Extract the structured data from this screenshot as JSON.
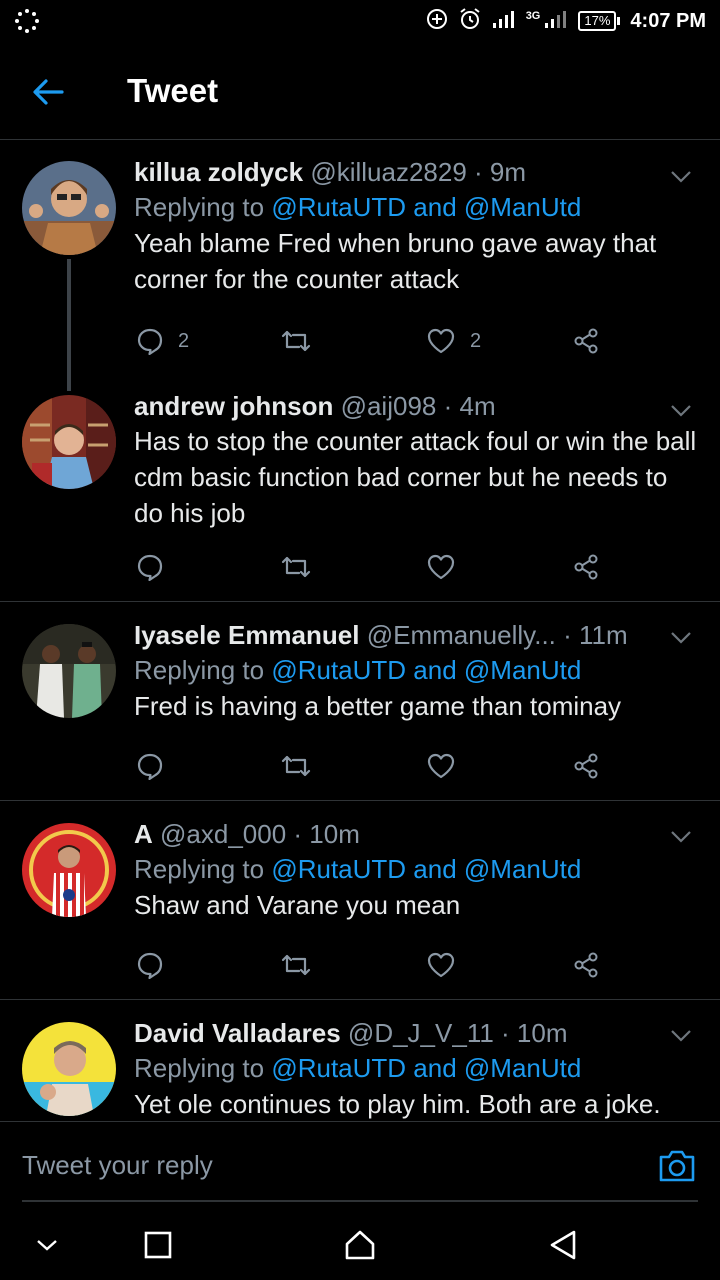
{
  "status_bar": {
    "time": "4:07 PM",
    "battery": "17%",
    "network": "3G"
  },
  "header": {
    "title": "Tweet"
  },
  "tweets": [
    {
      "name": "killua zoldyck",
      "handle": "@killuaz2829",
      "time": "· 9m",
      "replying_prefix": "Replying to",
      "replying_to": "@RutaUTD and @ManUtd",
      "text": "Yeah blame Fred when bruno gave away that corner for the counter attack",
      "reply_count": "2",
      "retweet_count": "",
      "like_count": "2"
    },
    {
      "name": "andrew johnson",
      "handle": "@aij098",
      "time": "· 4m",
      "text": "Has to stop the counter attack foul or win the ball cdm basic function bad corner but he needs to do his job",
      "reply_count": "",
      "retweet_count": "",
      "like_count": ""
    },
    {
      "name": "Iyasele Emmanuel",
      "handle": "@Emmanuelly...",
      "time": "· 11m",
      "replying_prefix": "Replying to",
      "replying_to": "@RutaUTD and @ManUtd",
      "text": "Fred is having a better game than tominay",
      "reply_count": "",
      "retweet_count": "",
      "like_count": ""
    },
    {
      "name": "A",
      "handle": "@axd_000",
      "time": "· 10m",
      "replying_prefix": "Replying to",
      "replying_to": "@RutaUTD and @ManUtd",
      "text": "Shaw and Varane you mean",
      "reply_count": "",
      "retweet_count": "",
      "like_count": ""
    },
    {
      "name": "David Valladares",
      "handle": "@D_J_V_11",
      "time": "· 10m",
      "replying_prefix": "Replying to",
      "replying_to": "@RutaUTD and @ManUtd",
      "text": "Yet ole continues to play him. Both are a joke."
    }
  ],
  "reply_bar": {
    "placeholder": "Tweet your reply"
  },
  "icons": {
    "back": "arrow-left-icon",
    "more": "chevron-down-icon",
    "reply": "speech-bubble-icon",
    "retweet": "retweet-icon",
    "like": "heart-icon",
    "share": "share-icon",
    "camera": "camera-icon"
  },
  "colors": {
    "accent": "#1d9bf0",
    "background": "#000000",
    "muted": "#8b98a5",
    "text": "#e7e9ea"
  }
}
